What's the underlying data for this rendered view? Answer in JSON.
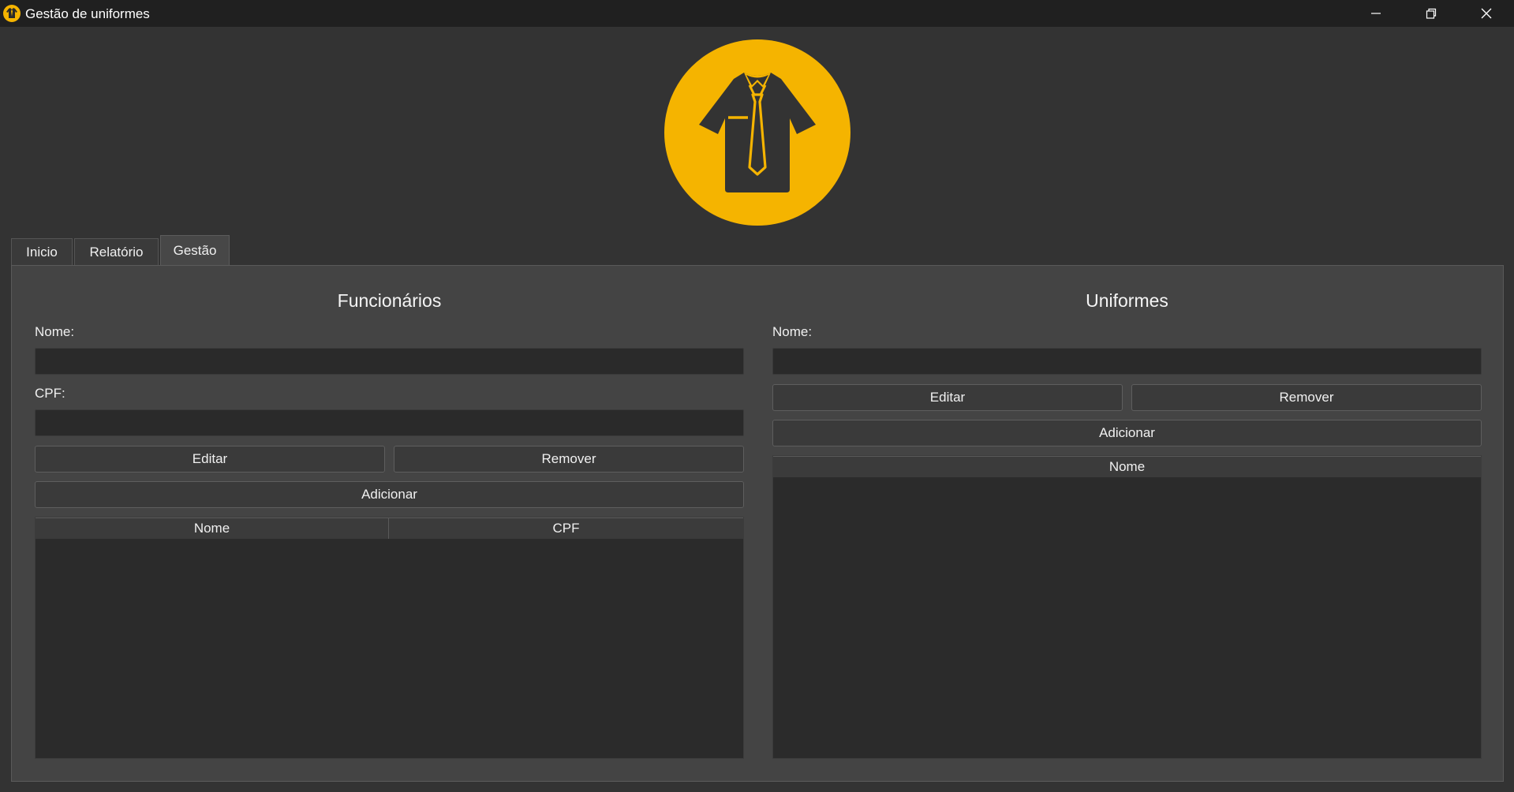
{
  "window": {
    "title": "Gestão de uniformes",
    "accent_color": "#f5b400",
    "controls": [
      "minimize-icon",
      "restore-icon",
      "close-icon"
    ]
  },
  "tabs": [
    {
      "label": "Inicio",
      "active": false
    },
    {
      "label": "Relatório",
      "active": false
    },
    {
      "label": "Gestão",
      "active": true
    }
  ],
  "funcionarios": {
    "title": "Funcionários",
    "nome_label": "Nome:",
    "nome_value": "",
    "cpf_label": "CPF:",
    "cpf_value": "",
    "edit_label": "Editar",
    "remove_label": "Remover",
    "add_label": "Adicionar",
    "table": {
      "columns": [
        "Nome",
        "CPF"
      ],
      "rows": []
    }
  },
  "uniformes": {
    "title": "Uniformes",
    "nome_label": "Nome:",
    "nome_value": "",
    "edit_label": "Editar",
    "remove_label": "Remover",
    "add_label": "Adicionar",
    "table": {
      "columns": [
        "Nome"
      ],
      "rows": []
    }
  }
}
